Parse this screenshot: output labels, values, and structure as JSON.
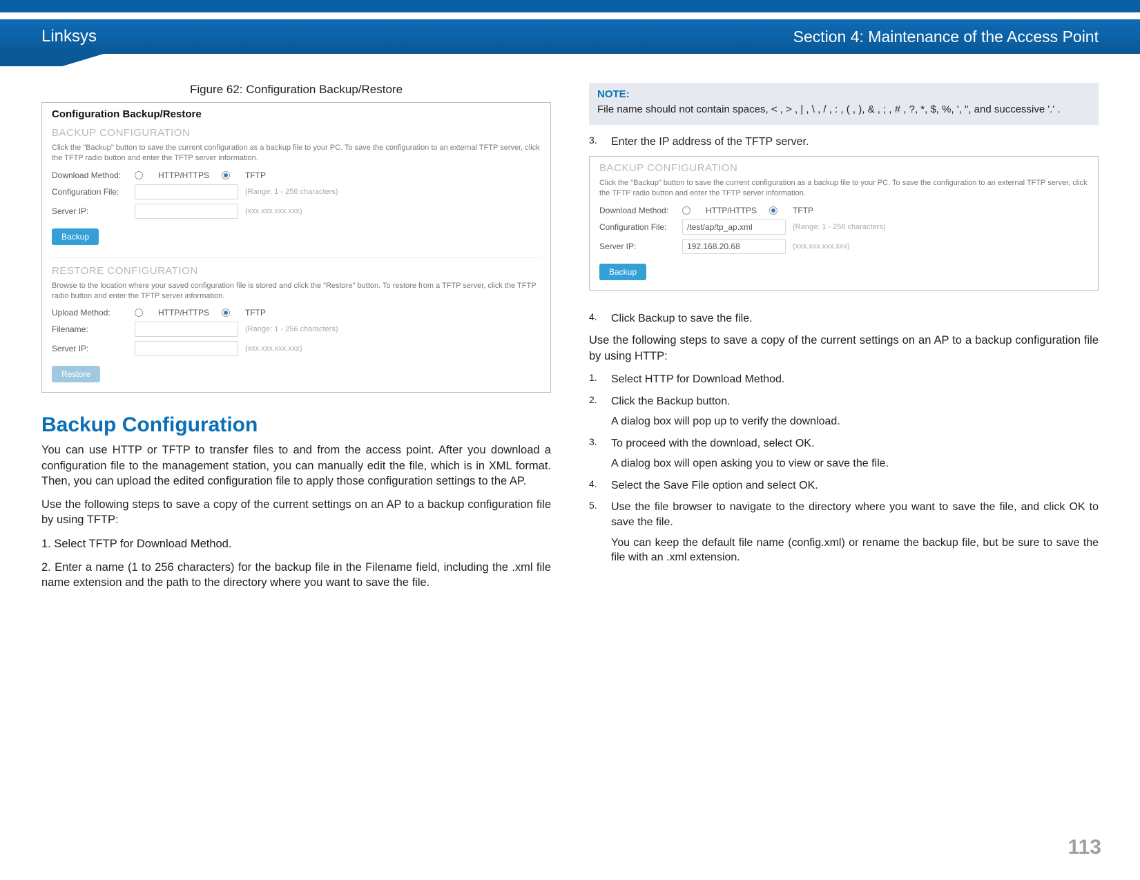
{
  "header": {
    "brand": "Linksys",
    "section": "Section 4: Maintenance of the Access Point"
  },
  "page_number": "113",
  "left": {
    "figure_caption": "Figure 62: Configuration Backup/Restore",
    "shot1": {
      "panel_title": "Configuration Backup/Restore",
      "backup_title": "BACKUP CONFIGURATION",
      "backup_desc": "Click the \"Backup\" button to save the current configuration as a backup file to your PC.\nTo save the configuration to an external TFTP server, click the TFTP radio button and enter the TFTP server information.",
      "dl_label": "Download Method:",
      "http_label": "HTTP/HTTPS",
      "tftp_label": "TFTP",
      "cfgfile_label": "Configuration File:",
      "cfgfile_hint": "(Range: 1 - 256 characters)",
      "serverip_label": "Server IP:",
      "serverip_hint": "(xxx.xxx.xxx.xxx)",
      "backup_btn": "Backup",
      "restore_title": "RESTORE CONFIGURATION",
      "restore_desc": "Browse to the location where your saved configuration file is stored and click the \"Restore\" button.\nTo restore from a TFTP server, click the TFTP radio button and enter the TFTP server information.",
      "ul_label": "Upload Method:",
      "filename_label": "Filename:",
      "filename_hint": "(Range: 1 - 256 characters)",
      "serverip_hint2": "(xxx.xxx.xxx.xxx)",
      "restore_btn": "Restore"
    },
    "section_heading": "Backup Configuration",
    "para1": "You can use HTTP or TFTP to transfer files to and from the access point. After you download a configuration file to the management station, you can manually edit the file, which is in XML format. Then, you can upload the edited configuration file to apply those configuration settings to the AP.",
    "para2": "Use the following steps to save a copy of the current settings on an AP to a backup configuration file by using TFTP:",
    "step1": "1.      Select TFTP for Download Method.",
    "step2": "2.      Enter a name (1 to 256 characters) for the backup file in the Filename field, including the .xml file name extension and the path to the directory where you want to save the file."
  },
  "right": {
    "note_title": "NOTE:",
    "note_body": "File name should not contain spaces, < , > , | , \\ , / , : , ( , ), & , ; , # , ?, *, $, %, ', \", and successive '.' .",
    "step3_label": "3.",
    "step3_text": "Enter the IP address of the TFTP server.",
    "shot2": {
      "backup_title": "BACKUP CONFIGURATION",
      "backup_desc": "Click the \"Backup\" button to save the current configuration as a backup file to your PC.\nTo save the configuration to an external TFTP server, click the TFTP radio button and enter the TFTP server information.",
      "dl_label": "Download Method:",
      "http_label": "HTTP/HTTPS",
      "tftp_label": "TFTP",
      "cfgfile_label": "Configuration File:",
      "cfgfile_value": "/test/ap/tp_ap.xml",
      "cfgfile_hint": "(Range: 1 - 256 characters)",
      "serverip_label": "Server IP:",
      "serverip_value": "192.168.20.68",
      "serverip_hint": "(xxx.xxx.xxx.xxx)",
      "backup_btn": "Backup"
    },
    "step4_label": "4.",
    "step4_text": "Click Backup to save the file.",
    "para3": "Use the following steps to save a copy of the current settings on an AP to a backup configuration file by using HTTP:",
    "http_steps": [
      {
        "n": "1.",
        "t": "Select HTTP for Download Method."
      },
      {
        "n": "2.",
        "t": "Click the Backup button.",
        "sub": "A dialog box will pop up to verify the download."
      },
      {
        "n": "3.",
        "t": "To proceed with the download, select OK.",
        "sub": "A dialog box will open asking you to view or save the file."
      },
      {
        "n": "4.",
        "t": "Select the Save File option and select OK."
      },
      {
        "n": "5.",
        "t": "Use the file browser to navigate to the directory where you want to save the file, and click OK to save the file.",
        "sub": "You can keep the default file name (config.xml) or rename the backup file, but be sure to save the file with an .xml extension."
      }
    ]
  }
}
